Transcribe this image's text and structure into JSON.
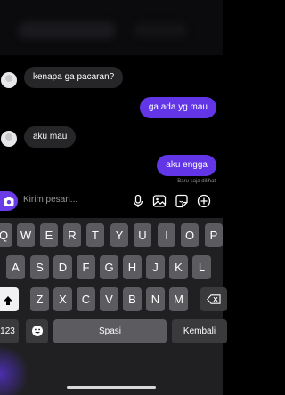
{
  "messages": [
    {
      "side": "in",
      "text": "kenapa ga pacaran?"
    },
    {
      "side": "out",
      "text": "ga ada yg mau"
    },
    {
      "side": "in",
      "text": "aku mau"
    },
    {
      "side": "out",
      "text": "aku engga"
    }
  ],
  "seen_text": "Baru saja dilihat",
  "composer": {
    "placeholder": "Kirim pesan...",
    "icons": [
      "camera-icon",
      "microphone-icon",
      "image-icon",
      "sticker-icon",
      "plus-icon"
    ]
  },
  "keyboard": {
    "row1": [
      "Q",
      "W",
      "E",
      "R",
      "T",
      "Y",
      "U",
      "I",
      "O",
      "P"
    ],
    "row2": [
      "A",
      "S",
      "D",
      "F",
      "G",
      "H",
      "J",
      "K",
      "L"
    ],
    "row3": [
      "Z",
      "X",
      "C",
      "V",
      "B",
      "N",
      "M"
    ],
    "numbers_label": "123",
    "space_label": "Spasi",
    "return_label": "Kembali",
    "icons": [
      "shift-icon",
      "backspace-icon",
      "emoji-icon"
    ]
  },
  "colors": {
    "accent": "#6236e6",
    "incoming": "#262628",
    "background": "#000000",
    "keyboard": "#202022"
  }
}
